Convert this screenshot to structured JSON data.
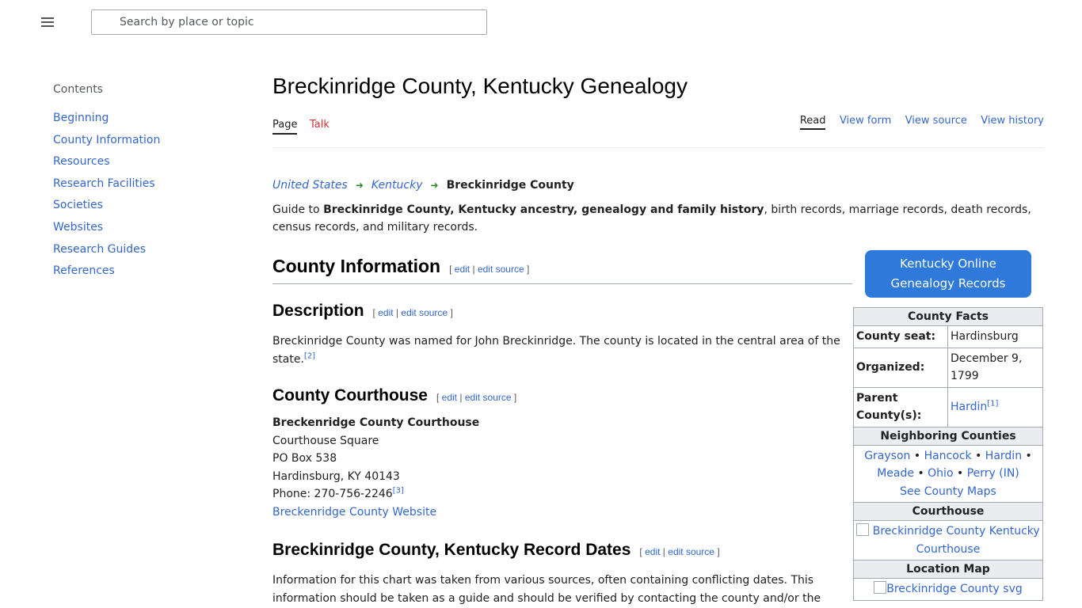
{
  "search": {
    "placeholder": "Search by place or topic"
  },
  "toc": {
    "title": "Contents",
    "items": [
      "Beginning",
      "County Information",
      "Resources",
      "Research Facilities",
      "Societies",
      "Websites",
      "Research Guides",
      "References"
    ]
  },
  "page": {
    "title": "Breckinridge County, Kentucky Genealogy",
    "tabs": {
      "page": "Page",
      "talk": "Talk",
      "read": "Read",
      "view_form": "View form",
      "view_source": "View source",
      "view_history": "View history"
    },
    "breadcrumb": {
      "us": "United States",
      "state": "Kentucky",
      "county": "Breckinridge County"
    },
    "intro": {
      "prefix": "Guide to ",
      "bold": "Breckinridge County, Kentucky ancestry, genealogy and family history",
      "suffix": ", birth records, marriage records, death records, census records, and military records."
    }
  },
  "edit": {
    "open": "[",
    "edit": "edit",
    "sep": "|",
    "edit_source": "edit source",
    "close": "]"
  },
  "sections": {
    "county_information": "County Information",
    "description": {
      "heading": "Description",
      "text": "Breckinridge County was named for John Breckinridge. The county is located in the central area of the state.",
      "ref": "[2]"
    },
    "courthouse": {
      "heading": "County Courthouse",
      "name": "Breckenridge County Courthouse",
      "line1": "Courthouse Square",
      "line2": "PO Box 538",
      "line3": "Hardinsburg, KY 40143",
      "phone": "Phone: 270-756-2246",
      "ref": "[3]",
      "website": "Breckenridge County Website"
    },
    "record_dates": {
      "heading": "Breckinridge County, Kentucky Record Dates",
      "text": "Information for this chart was taken from various sources, often containing conflicting dates. This information should be taken as a guide and should be verified by contacting the county and/or the"
    }
  },
  "sidebar_right": {
    "online_button": {
      "line1": "Kentucky Online",
      "line2": "Genealogy Records"
    },
    "facts": {
      "title": "County Facts",
      "seat_label": "County seat:",
      "seat_value": "Hardinsburg",
      "organized_label": "Organized:",
      "organized_value": "December 9, 1799",
      "parent_label": "Parent County(s):",
      "parent_value": "Hardin",
      "parent_ref": "[1]",
      "neighbors_title": "Neighboring Counties",
      "neighbors": [
        "Grayson",
        "Hancock",
        "Hardin",
        "Meade",
        "Ohio",
        "Perry (IN)"
      ],
      "bullet": "•",
      "maps_link": "See County Maps",
      "courthouse_title": "Courthouse",
      "courthouse_img_alt": "Breckinridge County Kentucky Courthouse",
      "location_title": "Location Map",
      "location_img_alt": "Breckinridge County svg"
    }
  }
}
